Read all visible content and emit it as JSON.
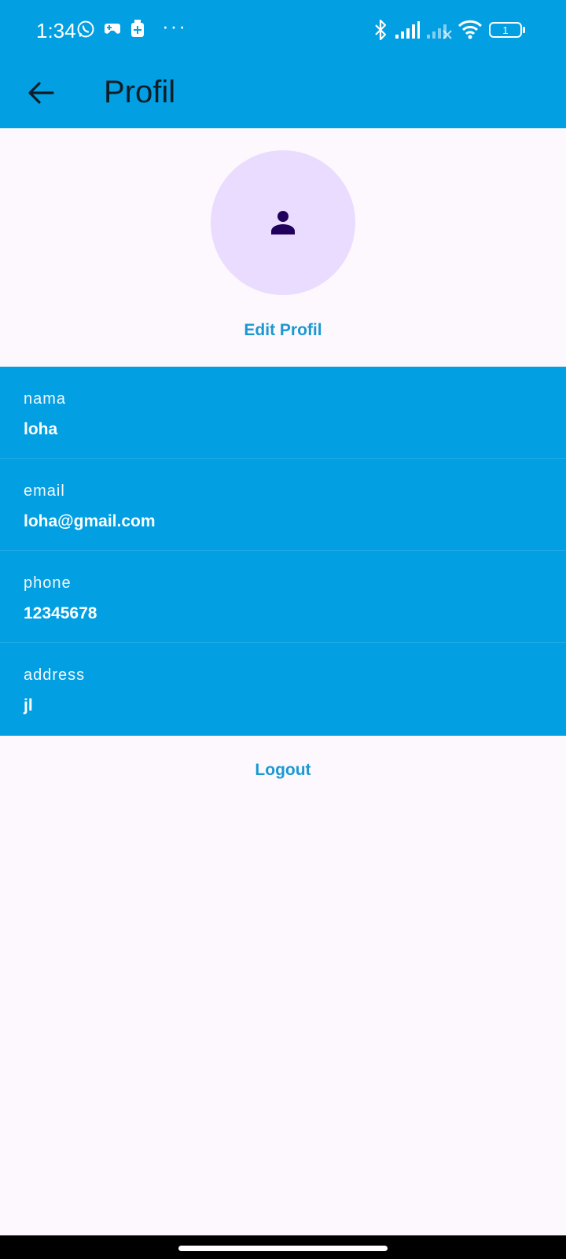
{
  "status_bar": {
    "time": "1:34",
    "dots": "···",
    "battery_level": "1",
    "icons_left": [
      "whatsapp-icon",
      "game-controller-icon",
      "medkit-icon"
    ],
    "icons_right": [
      "bluetooth-icon",
      "signal-icon",
      "signal-no-service-icon",
      "wifi-icon",
      "battery-icon"
    ]
  },
  "app_bar": {
    "title": "Profil",
    "back_icon": "arrow-left-icon"
  },
  "profile": {
    "avatar_icon": "person-icon",
    "edit_label": "Edit Profil"
  },
  "fields": [
    {
      "label": "nama",
      "value": "loha"
    },
    {
      "label": "email",
      "value": "loha@gmail.com"
    },
    {
      "label": "phone",
      "value": "12345678"
    },
    {
      "label": "address",
      "value": "jl"
    }
  ],
  "logout_label": "Logout",
  "colors": {
    "primary": "#029fe2",
    "accent_text": "#1a98d2",
    "avatar_bg": "#e9dcfe",
    "avatar_icon": "#21005d",
    "background": "#fdf8fd"
  }
}
